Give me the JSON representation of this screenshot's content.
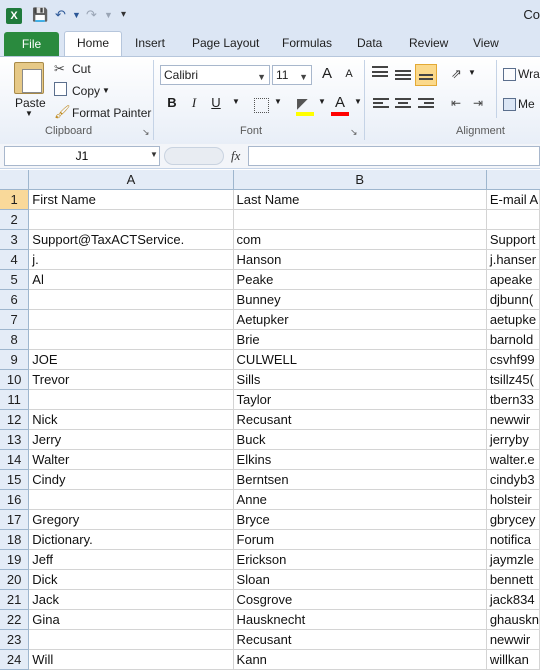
{
  "window": {
    "title": "Co"
  },
  "tabs": {
    "file": "File",
    "items": [
      "Home",
      "Insert",
      "Page Layout",
      "Formulas",
      "Data",
      "Review",
      "View"
    ]
  },
  "ribbon": {
    "clipboard": {
      "paste": "Paste",
      "cut": "Cut",
      "copy": "Copy",
      "format_painter": "Format Painter",
      "label": "Clipboard"
    },
    "font": {
      "name": "Calibri",
      "size": "11",
      "grow": "A",
      "shrink": "A",
      "bold": "B",
      "italic": "I",
      "underline": "U",
      "color_a": "A",
      "label": "Font"
    },
    "alignment": {
      "wrap": "Wra",
      "merge": "Me",
      "label": "Alignment"
    }
  },
  "formula_bar": {
    "name_box": "J1",
    "fx": "fx",
    "value": ""
  },
  "columns": [
    "A",
    "B"
  ],
  "rows": [
    [
      "1",
      "First Name",
      "Last Name",
      "E-mail A"
    ],
    [
      "2",
      "",
      "",
      ""
    ],
    [
      "3",
      "Support@TaxACTService.",
      "com",
      "Support"
    ],
    [
      "4",
      "j.",
      "Hanson",
      "j.hanser"
    ],
    [
      "5",
      "Al",
      "Peake",
      "apeake"
    ],
    [
      "6",
      "",
      "Bunney",
      "djbunn("
    ],
    [
      "7",
      "",
      "Aetupker",
      "aetupke"
    ],
    [
      "8",
      "",
      "Brie",
      "barnold"
    ],
    [
      "9",
      "JOE",
      "CULWELL",
      "csvhf99"
    ],
    [
      "10",
      "Trevor",
      "Sills",
      "tsillz45("
    ],
    [
      "11",
      "",
      "Taylor",
      "tbern33"
    ],
    [
      "12",
      "Nick",
      "Recusant",
      "newwir"
    ],
    [
      "13",
      "Jerry",
      "Buck",
      "jerryby"
    ],
    [
      "14",
      "Walter",
      "Elkins",
      "walter.e"
    ],
    [
      "15",
      "Cindy",
      "Berntsen",
      "cindyb3"
    ],
    [
      "16",
      "",
      "Anne",
      "holsteir"
    ],
    [
      "17",
      "Gregory",
      "Bryce",
      "gbrycey"
    ],
    [
      "18",
      "Dictionary.",
      "Forum",
      "notifica"
    ],
    [
      "19",
      "Jeff",
      "Erickson",
      "jaymzle"
    ],
    [
      "20",
      "Dick",
      "Sloan",
      "bennett"
    ],
    [
      "21",
      "Jack",
      "Cosgrove",
      "jack834"
    ],
    [
      "22",
      "Gina",
      "Hausknecht",
      "ghauskn"
    ],
    [
      "23",
      "",
      "Recusant",
      "newwir"
    ],
    [
      "24",
      "Will",
      "Kann",
      "willkan"
    ]
  ]
}
